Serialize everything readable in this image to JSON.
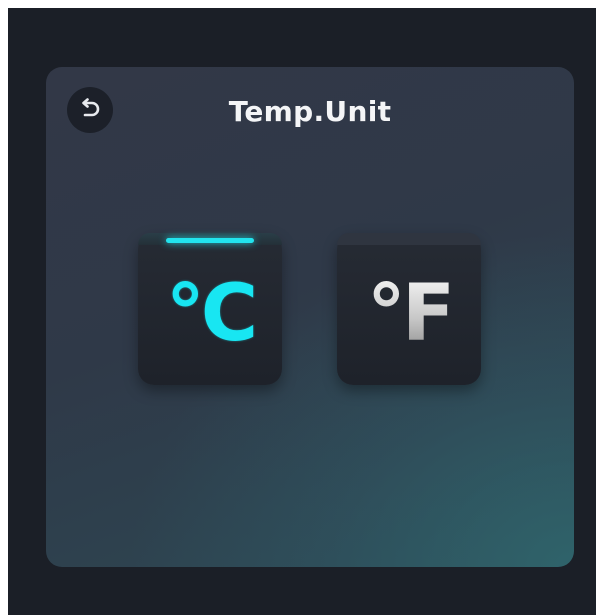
{
  "screen": {
    "title": "Temp.Unit",
    "back_icon": "undo-arrow-icon"
  },
  "units": [
    {
      "label": "°C",
      "selected": true
    },
    {
      "label": "°F",
      "selected": false
    }
  ],
  "colors": {
    "accent": "#18e6f2",
    "background": "#1b1f27",
    "button": "#1e222a",
    "title_text": "#f4f5f7"
  }
}
